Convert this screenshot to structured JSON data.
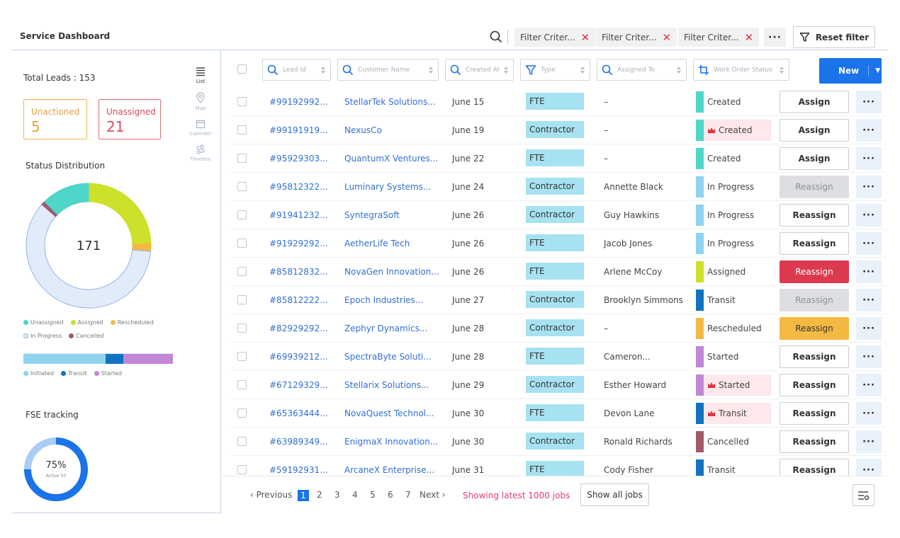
{
  "app_title": "Service Dashboard",
  "header": {
    "filters": [
      {
        "label": "Filter Criter..."
      },
      {
        "label": "Filter Criter..."
      },
      {
        "label": "Filter Criter..."
      }
    ],
    "reset_label": "Reset filter"
  },
  "sidebar": {
    "total_leads": "Total Leads : 153",
    "unactioned": {
      "label": "Unactioned",
      "value": "5"
    },
    "unassigned": {
      "label": "Unassigned",
      "value": "21"
    },
    "status_title": "Status Distribution",
    "donut_total": "171",
    "donut_segments": [
      {
        "name": "Assigned",
        "value": 0.245,
        "color": "#cde02a"
      },
      {
        "name": "Rescheduled",
        "value": 0.02,
        "color": "#f4b942"
      },
      {
        "name": "In Progress",
        "value": 0.6,
        "color": "#e1ebfa"
      },
      {
        "name": "Cancelled",
        "value": 0.01,
        "color": "#a05a6a"
      },
      {
        "name": "Unassigned",
        "value": 0.125,
        "color": "#4fd6c8"
      }
    ],
    "legend1": [
      {
        "label": "Unassigned",
        "color": "#4fd6c8"
      },
      {
        "label": "Assigned",
        "color": "#cde02a"
      },
      {
        "label": "Rescheduled",
        "color": "#f4b942"
      }
    ],
    "legend2": [
      {
        "label": "In Progress",
        "color": "#e1ebfa"
      },
      {
        "label": "Cancelled",
        "color": "#a05a6a"
      }
    ],
    "stack": [
      {
        "name": "Initiated",
        "value": 0.55,
        "color": "#8fd3ee"
      },
      {
        "name": "Transit",
        "value": 0.12,
        "color": "#1272c2"
      },
      {
        "name": "Started",
        "value": 0.33,
        "color": "#c287d6"
      }
    ],
    "legend3": [
      {
        "label": "Initiated",
        "color": "#8fd3ee"
      },
      {
        "label": "Transit",
        "color": "#1272c2"
      },
      {
        "label": "Started",
        "color": "#c287d6"
      }
    ],
    "fse_title": "FSE tracking",
    "fse_percent": "75%",
    "fse_value": 0.75,
    "fse_sub": "Active 50",
    "views": [
      {
        "label": "List",
        "icon": "list-icon",
        "active": true
      },
      {
        "label": "Map",
        "icon": "map-pin-icon",
        "active": false
      },
      {
        "label": "Calender",
        "icon": "calendar-icon",
        "active": false
      },
      {
        "label": "Timeline",
        "icon": "timeline-icon",
        "active": false
      }
    ]
  },
  "table": {
    "columns": [
      {
        "key": "lead",
        "placeholder": "Lead Id",
        "icon": "search-icon"
      },
      {
        "key": "customer",
        "placeholder": "Customer Name",
        "icon": "search-icon"
      },
      {
        "key": "created",
        "placeholder": "Created At",
        "icon": "search-icon"
      },
      {
        "key": "type",
        "placeholder": "Type",
        "icon": "filter-icon"
      },
      {
        "key": "assigned",
        "placeholder": "Assigned To",
        "icon": "search-icon"
      },
      {
        "key": "status",
        "placeholder": "Work Order Status",
        "icon": "crop-icon"
      }
    ],
    "new_label": "New",
    "rows": [
      {
        "lead": "#99192992...",
        "customer": "StellarTek Solutions...",
        "date": "June 15",
        "type": "FTE",
        "assigned": "–",
        "status": "Created",
        "status_color": "#4fd6c8",
        "flagged": false,
        "action": "Assign",
        "action_style": "normal"
      },
      {
        "lead": "#99191919...",
        "customer": "NexusCo",
        "date": "June 19",
        "type": "Contractor",
        "assigned": "–",
        "status": "Created",
        "status_color": "#4fd6c8",
        "flagged": true,
        "action": "Assign",
        "action_style": "normal"
      },
      {
        "lead": "#95929303...",
        "customer": "QuantumX Ventures...",
        "date": "June 22",
        "type": "FTE",
        "assigned": "–",
        "status": "Created",
        "status_color": "#4fd6c8",
        "flagged": false,
        "action": "Assign",
        "action_style": "normal"
      },
      {
        "lead": "#95812322...",
        "customer": "Luminary Systems...",
        "date": "June 24",
        "type": "Contractor",
        "assigned": "Annette Black",
        "status": "In Progress",
        "status_color": "#8fd3ee",
        "flagged": false,
        "action": "Reassign",
        "action_style": "disabled"
      },
      {
        "lead": "#91941232...",
        "customer": "SyntegraSoft",
        "date": "June 26",
        "type": "Contractor",
        "assigned": "Guy Hawkins",
        "status": "In Progress",
        "status_color": "#8fd3ee",
        "flagged": false,
        "action": "Reassign",
        "action_style": "normal"
      },
      {
        "lead": "#91929292...",
        "customer": "AetherLife Tech",
        "date": "June 26",
        "type": "FTE",
        "assigned": "Jacob Jones",
        "status": "In Progress",
        "status_color": "#8fd3ee",
        "flagged": false,
        "action": "Reassign",
        "action_style": "normal"
      },
      {
        "lead": "#85812832...",
        "customer": "NovaGen Innovation...",
        "date": "June 26",
        "type": "FTE",
        "assigned": "Arlene McCoy",
        "status": "Assigned",
        "status_color": "#cde02a",
        "flagged": false,
        "action": "Reassign",
        "action_style": "red"
      },
      {
        "lead": "#85812222...",
        "customer": "Epoch Industries...",
        "date": "June 27",
        "type": "Contractor",
        "assigned": "Brooklyn Simmons",
        "status": "Transit",
        "status_color": "#1272c2",
        "flagged": false,
        "action": "Reassign",
        "action_style": "disabled"
      },
      {
        "lead": "#82929292...",
        "customer": "Zephyr Dynamics...",
        "date": "June 28",
        "type": "Contractor",
        "assigned": "–",
        "status": "Rescheduled",
        "status_color": "#f4b942",
        "flagged": false,
        "action": "Reassign",
        "action_style": "yellow"
      },
      {
        "lead": "#69939212...",
        "customer": "SpectraByte Soluti...",
        "date": "June 28",
        "type": "FTE",
        "assigned": "Cameron...",
        "status": "Started",
        "status_color": "#c287d6",
        "flagged": false,
        "action": "Reassign",
        "action_style": "normal"
      },
      {
        "lead": "#67129329...",
        "customer": "Stellarix Solutions...",
        "date": "June 29",
        "type": "Contractor",
        "assigned": "Esther Howard",
        "status": "Started",
        "status_color": "#c287d6",
        "flagged": true,
        "action": "Reassign",
        "action_style": "normal"
      },
      {
        "lead": "#65363444...",
        "customer": "NovaQuest Technol...",
        "date": "June 30",
        "type": "FTE",
        "assigned": "Devon Lane",
        "status": "Transit",
        "status_color": "#1272c2",
        "flagged": true,
        "action": "Reassign",
        "action_style": "normal"
      },
      {
        "lead": "#63989349...",
        "customer": "EnigmaX Innovation...",
        "date": "June 30",
        "type": "Contractor",
        "assigned": "Ronald Richards",
        "status": "Cancelled",
        "status_color": "#a05a6a",
        "flagged": false,
        "action": "Reassign",
        "action_style": "normal"
      },
      {
        "lead": "#59192931...",
        "customer": "ArcaneX Enterprise...",
        "date": "June 31",
        "type": "FTE",
        "assigned": "Cody Fisher",
        "status": "Transit",
        "status_color": "#1272c2",
        "flagged": false,
        "action": "Reassign",
        "action_style": "normal"
      }
    ]
  },
  "pagination": {
    "previous": "‹ Previous",
    "pages": [
      "1",
      "2",
      "3",
      "4",
      "5",
      "6",
      "7"
    ],
    "current": "1",
    "next": "Next ›",
    "showing": "Showing latest 1000 jobs",
    "show_all": "Show all jobs"
  }
}
